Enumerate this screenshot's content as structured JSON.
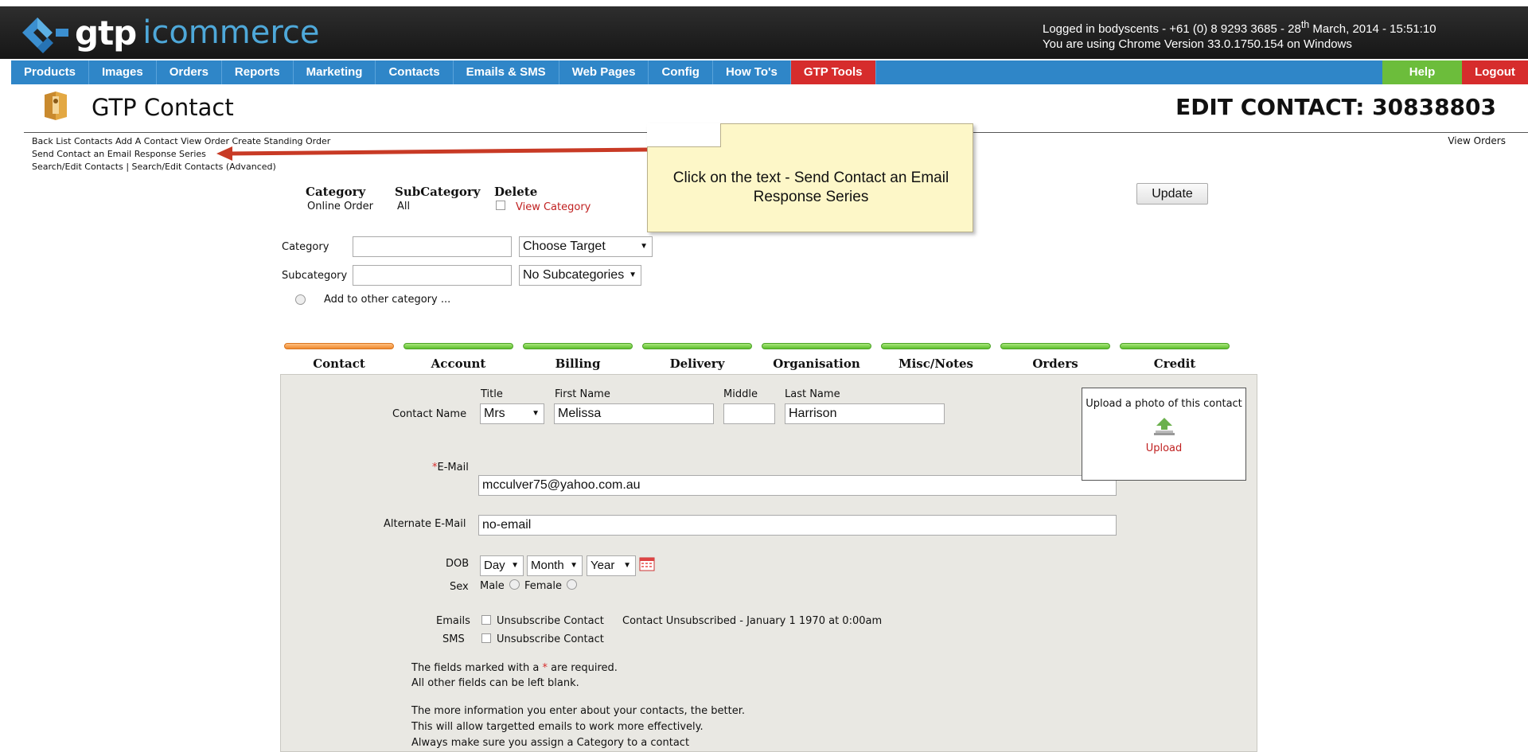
{
  "header": {
    "brand_gtp": "gtp",
    "brand_icommerce": "icommerce",
    "login_line1": "Logged in bodyscents - +61 (0) 8 9293 3685  - 28",
    "login_sup": "th",
    "login_line1_end": " March, 2014 - 15:51:10",
    "login_line2": "You are using Chrome Version 33.0.1750.154 on Windows"
  },
  "nav": {
    "items": [
      "Products",
      "Images",
      "Orders",
      "Reports",
      "Marketing",
      "Contacts",
      "Emails & SMS",
      "Web Pages",
      "Config",
      "How To's"
    ],
    "gtp_tools": "GTP Tools",
    "help": "Help",
    "logout": "Logout"
  },
  "page": {
    "title": "GTP Contact",
    "edit_title": "EDIT CONTACT: 30838803"
  },
  "links": {
    "back": "Back",
    "list_contacts": "List Contacts",
    "add_contact": "Add A Contact",
    "view_order": "View Order",
    "create_standing_order": "Create Standing Order",
    "send_email_series": "Send Contact an Email Response Series",
    "search_edit": "Search/Edit Contacts",
    "separator": "|",
    "search_edit_advanced": "Search/Edit Contacts (Advanced)",
    "view_orders": "View Orders"
  },
  "callout": {
    "text": "Click on the text - Send Contact an Email Response Series"
  },
  "category": {
    "head_category": "Category",
    "head_subcategory": "SubCategory",
    "head_delete": "Delete",
    "val_category": "Online Order",
    "val_subcategory": "All",
    "view_category": "View Category",
    "update": "Update",
    "label_category": "Category",
    "label_subcategory": "Subcategory",
    "choose_target": "Choose Target",
    "no_subcategories": "No Subcategories",
    "add_other": "Add to other category ..."
  },
  "tabs": [
    "Contact",
    "Account",
    "Billing",
    "Delivery",
    "Organisation",
    "Misc/Notes",
    "Orders",
    "Credit"
  ],
  "form": {
    "contact_name_label": "Contact Name",
    "title_label": "Title",
    "first_name_label": "First Name",
    "middle_label": "Middle",
    "last_name_label": "Last Name",
    "title_value": "Mrs",
    "first_name": "Melissa",
    "middle": "",
    "last_name": "Harrison",
    "email_req": "*",
    "email_label": "E-Mail",
    "email": "mcculver75@yahoo.com.au",
    "alt_email_label": "Alternate E-Mail",
    "alt_email": "no-email",
    "dob_label": "DOB",
    "dob_day": "Day",
    "dob_month": "Month",
    "dob_year": "Year",
    "sex_label": "Sex",
    "sex_male": "Male",
    "sex_female": "Female",
    "emails_label": "Emails",
    "unsubscribe": "Unsubscribe Contact",
    "unsubscribed_status": "Contact Unsubscribed - January 1 1970 at 0:00am",
    "sms_label": "SMS",
    "note1_a": "The fields marked with a ",
    "note1_star": "*",
    "note1_b": " are required.",
    "note2": "All other fields can be left blank.",
    "note3": "The more information you enter about your contacts, the better.",
    "note4": "This will allow targetted emails to work more effectively.",
    "note5": "Always make sure you assign a Category to a contact"
  },
  "upload": {
    "text": "Upload a photo of this contact",
    "link": "Upload"
  },
  "colors": {
    "nav_blue": "#2f86c8",
    "red": "#d62c2c",
    "green": "#6cbd3b",
    "callout_bg": "#fdf7c8"
  }
}
